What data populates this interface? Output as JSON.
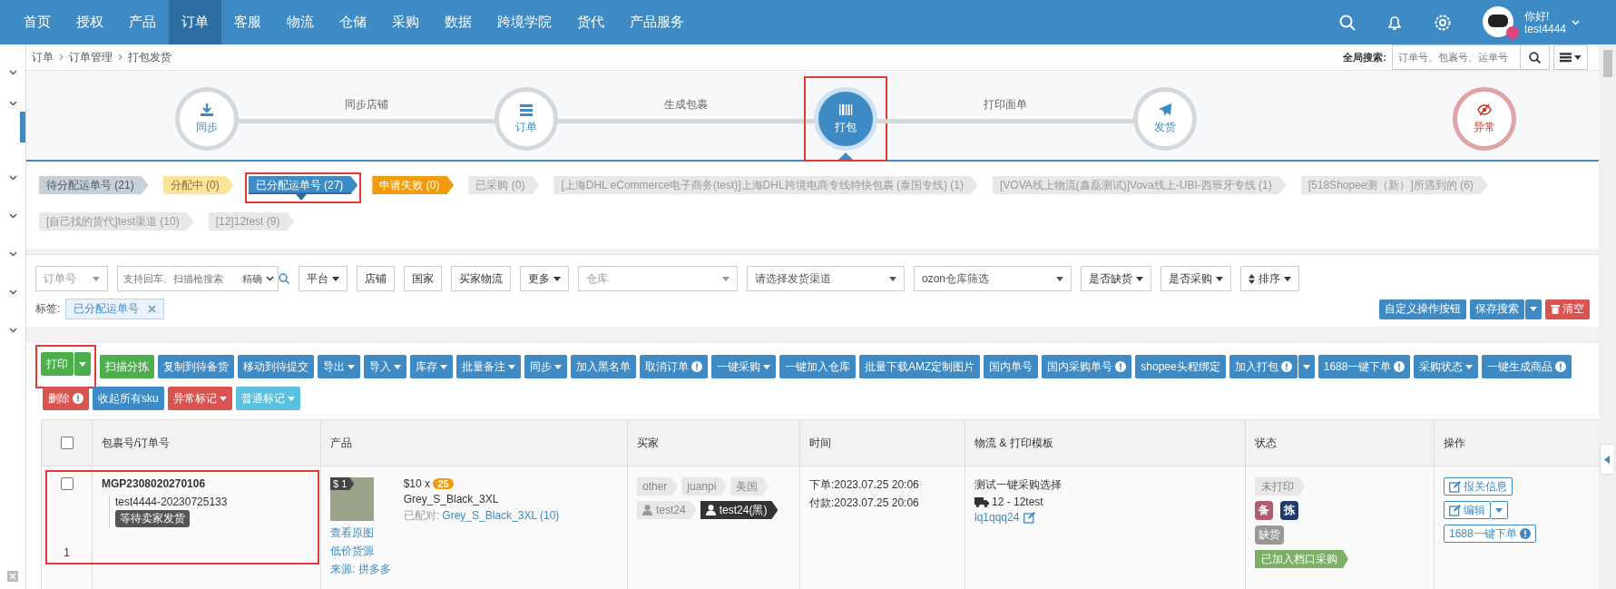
{
  "nav": {
    "items": [
      {
        "label": "首页",
        "selected": false
      },
      {
        "label": "授权",
        "selected": false
      },
      {
        "label": "产品",
        "selected": false
      },
      {
        "label": "订单",
        "selected": true
      },
      {
        "label": "客服",
        "selected": false
      },
      {
        "label": "物流",
        "selected": false
      },
      {
        "label": "仓储",
        "selected": false
      },
      {
        "label": "采购",
        "selected": false
      },
      {
        "label": "数据",
        "selected": false
      },
      {
        "label": "跨境学院",
        "selected": false
      },
      {
        "label": "货代",
        "selected": false
      },
      {
        "label": "产品服务",
        "selected": false
      }
    ],
    "user": {
      "greeting": "你好!",
      "name": "test4444"
    }
  },
  "breadcrumb": [
    "订单",
    "订单管理",
    "打包发货"
  ],
  "global_search": {
    "label": "全局搜索:",
    "placeholder": "订单号、包裹号、运单号"
  },
  "steps": [
    {
      "label": "同步",
      "kind": "step",
      "selected": false,
      "highlighted": false
    },
    {
      "label": "订单",
      "kind": "step",
      "selected": false,
      "highlighted": false
    },
    {
      "label": "打包",
      "kind": "step",
      "selected": true,
      "highlighted": true
    },
    {
      "label": "发货",
      "kind": "step",
      "selected": false,
      "highlighted": false
    },
    {
      "label": "异常",
      "kind": "alert",
      "selected": false,
      "highlighted": false
    }
  ],
  "step_links": [
    "同步店铺",
    "生成包裹",
    "打印面单"
  ],
  "status_tabs": [
    {
      "label": "待分配运单号 (21)",
      "kind": "pending",
      "selected": false,
      "highlighted": false
    },
    {
      "label": "分配中 (0)",
      "kind": "assigning",
      "selected": false,
      "highlighted": false
    },
    {
      "label": "已分配运单号 (27)",
      "kind": "assigned",
      "selected": true,
      "highlighted": true
    },
    {
      "label": "申请失败 (0)",
      "kind": "failed",
      "selected": false,
      "highlighted": false
    },
    {
      "label": "已采购 (0)",
      "kind": "channel",
      "selected": false,
      "highlighted": false
    },
    {
      "label": "[上海DHL eCommerce电子商务(test)]上海DHL跨境电商专线特快包裹 (泰国专线) (1)",
      "kind": "channel",
      "selected": false,
      "highlighted": false
    },
    {
      "label": "[VOVA线上物流(鑫磊测试)]Vova线上-UBI-西班牙专线 (1)",
      "kind": "channel",
      "selected": false,
      "highlighted": false
    },
    {
      "label": "[518Shopee测（新）]所遇到的 (6)",
      "kind": "channel",
      "selected": false,
      "highlighted": false
    },
    {
      "label": "[自己找的货代]test渠道 (10)",
      "kind": "channel",
      "selected": false,
      "highlighted": false
    },
    {
      "label": "[12]12test (9)",
      "kind": "channel",
      "selected": false,
      "highlighted": false
    }
  ],
  "filters": {
    "field_select": "订单号",
    "search": {
      "placeholder": "支持回车、扫描枪搜索",
      "mode": "精确"
    },
    "buttons": [
      {
        "label": "平台",
        "caret": true
      },
      {
        "label": "店铺",
        "caret": false
      },
      {
        "label": "国家",
        "caret": false
      },
      {
        "label": "买家物流",
        "caret": false
      },
      {
        "label": "更多",
        "caret": true
      }
    ],
    "selects": [
      {
        "placeholder": "仓库"
      },
      {
        "value": "请选择发货渠道"
      },
      {
        "value": "ozon仓库筛选"
      }
    ],
    "buttons_2": [
      {
        "label": "是否缺货",
        "kind": "plain"
      },
      {
        "label": "是否采购",
        "kind": "plain"
      },
      {
        "label": "排序",
        "kind": "sort"
      }
    ]
  },
  "tag_filter": {
    "label": "标签:",
    "chips": [
      "已分配运单号"
    ]
  },
  "right_actions": [
    {
      "label": "自定义操作按钮",
      "kind": "blue",
      "split": false
    },
    {
      "label": "保存搜索",
      "kind": "blue",
      "split": true
    },
    {
      "label": "清空",
      "kind": "danger",
      "split": false
    }
  ],
  "actions": [
    {
      "label": "打印",
      "kind": "green",
      "caret": false,
      "split": true,
      "info": false,
      "highlighted": true
    },
    {
      "label": "扫描分拣",
      "kind": "green",
      "caret": false,
      "split": false,
      "info": false,
      "highlighted": false
    },
    {
      "label": "复制到待备货",
      "kind": "blue",
      "caret": false,
      "split": false,
      "info": false,
      "highlighted": false
    },
    {
      "label": "移动到待提交",
      "kind": "blue",
      "caret": false,
      "split": false,
      "info": false,
      "highlighted": false
    },
    {
      "label": "导出",
      "kind": "blue",
      "caret": true,
      "split": false,
      "info": false,
      "highlighted": false
    },
    {
      "label": "导入",
      "kind": "blue",
      "caret": true,
      "split": false,
      "info": false,
      "highlighted": false
    },
    {
      "label": "库存",
      "kind": "blue",
      "caret": true,
      "split": false,
      "info": false,
      "highlighted": false
    },
    {
      "label": "批量备注",
      "kind": "blue",
      "caret": true,
      "split": false,
      "info": false,
      "highlighted": false
    },
    {
      "label": "同步",
      "kind": "blue",
      "caret": true,
      "split": false,
      "info": false,
      "highlighted": false
    },
    {
      "label": "加入黑名单",
      "kind": "blue",
      "caret": false,
      "split": false,
      "info": false,
      "highlighted": false
    },
    {
      "label": "取消订单",
      "kind": "blue",
      "caret": false,
      "split": false,
      "info": true,
      "highlighted": false
    },
    {
      "label": "一键采购",
      "kind": "blue",
      "caret": true,
      "split": false,
      "info": false,
      "highlighted": false
    },
    {
      "label": "一键加入仓库",
      "kind": "blue",
      "caret": false,
      "split": false,
      "info": false,
      "highlighted": false
    },
    {
      "label": "批量下载AMZ定制图片",
      "kind": "blue",
      "caret": false,
      "split": false,
      "info": false,
      "highlighted": false
    },
    {
      "label": "国内单号",
      "kind": "blue",
      "caret": false,
      "split": false,
      "info": false,
      "highlighted": false
    },
    {
      "label": "国内采购单号",
      "kind": "blue",
      "caret": false,
      "split": false,
      "info": true,
      "highlighted": false
    },
    {
      "label": "shopee头程绑定",
      "kind": "blue",
      "caret": false,
      "split": false,
      "info": false,
      "highlighted": false
    },
    {
      "label": "加入打包",
      "kind": "blue",
      "caret": false,
      "split": true,
      "info": true,
      "highlighted": false
    },
    {
      "label": "1688一键下单",
      "kind": "blue",
      "caret": false,
      "split": false,
      "info": true,
      "highlighted": false
    },
    {
      "label": "采购状态",
      "kind": "blue",
      "caret": true,
      "split": false,
      "info": false,
      "highlighted": false
    },
    {
      "label": "一键生成商品",
      "kind": "blue",
      "caret": false,
      "split": false,
      "info": true,
      "highlighted": false
    },
    {
      "label": "删除",
      "kind": "red",
      "caret": false,
      "split": false,
      "info": true,
      "highlighted": false
    },
    {
      "label": "收起所有sku",
      "kind": "blue",
      "caret": false,
      "split": false,
      "info": false,
      "highlighted": false
    },
    {
      "label": "异常标记",
      "kind": "red",
      "caret": true,
      "split": false,
      "info": false,
      "highlighted": false
    },
    {
      "label": "普通标记",
      "kind": "cyan",
      "caret": true,
      "split": false,
      "info": false,
      "highlighted": false
    }
  ],
  "table": {
    "select_all": {
      "checked": false
    },
    "columns": [
      "包裹号/订单号",
      "产品",
      "买家",
      "时间",
      "物流 & 打印模板",
      "状态",
      "操作"
    ],
    "rows": [
      {
        "checked": false,
        "highlighted": true,
        "index": "1",
        "package_no": "MGP2308020270106",
        "order_no": "test4444-20230725133",
        "order_status": "等待卖家发货",
        "product": {
          "price_tag": "$ 1",
          "price": "$10 x",
          "quantity": "25",
          "sku": "Grey_S_Black_3XL",
          "matched_label": "已配对:",
          "matched": "Grey_S_Black_3XL (10)",
          "links": [
            "查看原图",
            "低价货源"
          ],
          "source": "来源: 拼多多"
        },
        "buyer_tags": [
          {
            "label": "other",
            "kind": "plain"
          },
          {
            "label": "juanpi",
            "kind": "plain"
          },
          {
            "label": "美国",
            "kind": "plain"
          },
          {
            "label": "test24",
            "kind": "user"
          },
          {
            "label": "test24(黑)",
            "kind": "blacklist"
          }
        ],
        "times": [
          "下单:2023.07.25 20:06",
          "付款:2023.07.25 20:06"
        ],
        "logistics": {
          "template": "测试一键采购选择",
          "channel": "12 - 12test",
          "tracking": "lq1qqq24"
        },
        "status": {
          "print_state": "未打印",
          "marks": [
            {
              "label": "备",
              "color": "#b05d6e"
            },
            {
              "label": "拣",
              "color": "#1e3a6e"
            }
          ],
          "stock": "缺货",
          "purchase": "已加入档口采购"
        },
        "operations": [
          {
            "label": "报关信息",
            "kind": "edit"
          },
          {
            "label": "编辑",
            "kind": "edit-split"
          },
          {
            "label": "1688一键下单",
            "kind": "info"
          }
        ]
      }
    ]
  }
}
